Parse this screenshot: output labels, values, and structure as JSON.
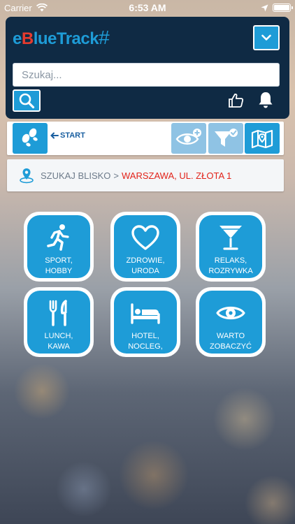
{
  "status_bar": {
    "carrier": "Carrier",
    "time": "6:53 AM"
  },
  "header": {
    "logo": {
      "e": "e",
      "b": "B",
      "rest": "lueTrack",
      "hash": "#"
    },
    "search_placeholder": "Szukaj..."
  },
  "toolbar": {
    "start_label": "START"
  },
  "location": {
    "prefix": "SZUKAJ BLISKO",
    "separator": ">",
    "value": "WARSZAWA, UL. ZŁOTA 1"
  },
  "categories": [
    {
      "line1": "SPORT,",
      "line2": "HOBBY",
      "icon": "running-person-icon"
    },
    {
      "line1": "ZDROWIE,",
      "line2": "URODA",
      "icon": "heart-icon"
    },
    {
      "line1": "RELAKS,",
      "line2": "ROZRYWKA",
      "icon": "cocktail-glass-icon"
    },
    {
      "line1": "LUNCH,",
      "line2": "KAWA",
      "icon": "fork-knife-icon"
    },
    {
      "line1": "HOTEL,",
      "line2": "NOCLEG,",
      "icon": "bed-icon"
    },
    {
      "line1": "WARTO",
      "line2": "ZOBACZYĆ",
      "icon": "eye-icon"
    }
  ],
  "colors": {
    "navy": "#0f2a44",
    "accent": "#1e9cd7",
    "red": "#e2231a"
  }
}
